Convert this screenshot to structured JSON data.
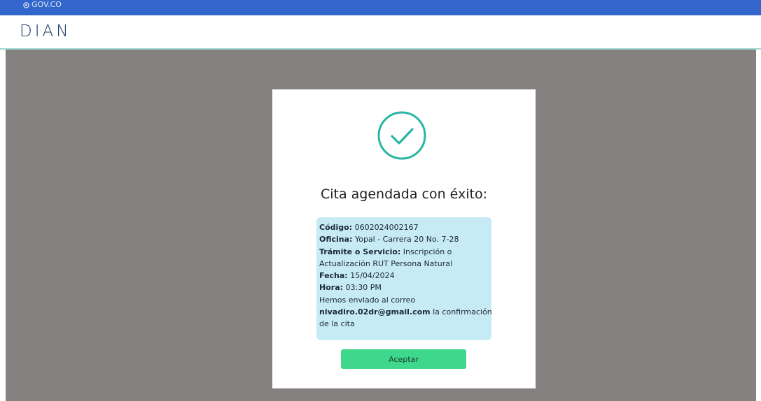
{
  "gov_bar": {
    "label": "GOV.CO"
  },
  "header": {
    "logo_text": "DIAN"
  },
  "modal": {
    "title": "Cita agendada con éxito:",
    "details": {
      "codigo_label": "Código:",
      "codigo_value": " 0602024002167",
      "oficina_label": "Oficina:",
      "oficina_value": " Yopal - Carrera 20 No. 7-28",
      "tramite_label": "Trámite o Servicio:",
      "tramite_value_1": " Inscripción o",
      "tramite_value_2": "Actualización RUT Persona Natural",
      "fecha_label": "Fecha:",
      "fecha_value": " 15/04/2024",
      "hora_label": "Hora:",
      "hora_value": " 03:30 PM",
      "message_1": "Hemos enviado al correo",
      "email": "nivadiro.02dr@gmail.com",
      "message_2": " la confirmación",
      "message_3": "de la cita"
    },
    "accept_button": "Aceptar"
  },
  "colors": {
    "gov_bar": "#3366cc",
    "overlay": "#858180",
    "check_circle": "#2ab5a5",
    "info_box": "#c6ebf4",
    "accept_button": "#3fd78c"
  }
}
